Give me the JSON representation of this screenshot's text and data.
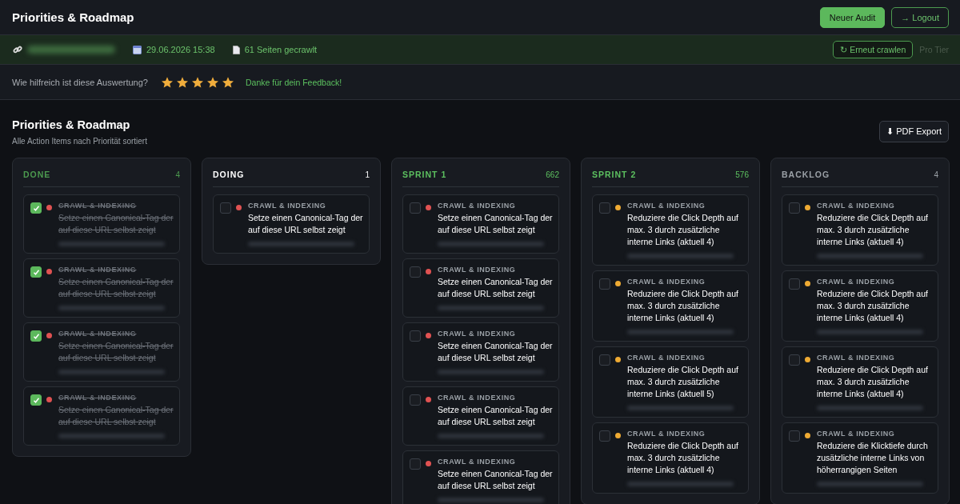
{
  "header": {
    "title": "Priorities & Roadmap",
    "buttons": [
      {
        "label": "Neuer Audit",
        "kind": "primary"
      },
      {
        "label": "→ Logout",
        "kind": "outline"
      }
    ]
  },
  "info_bar": {
    "date": "29.06.2026 15:38",
    "pages": "61 Seiten gecrawlt",
    "recrawl": "↻ Erneut crawlen",
    "tier": "Pro Tier"
  },
  "feedback": {
    "question": "Wie hilfreich ist diese Auswertung?",
    "stars": 5,
    "thanks": "Danke für dein Feedback!"
  },
  "section": {
    "title": "Priorities & Roadmap",
    "subtitle": "Alle Action Items nach Priorität sortiert",
    "export": "⬇ PDF Export"
  },
  "columns": [
    {
      "title": "DONE",
      "count": "4",
      "color": "#4c9a4f",
      "cards": [
        {
          "checked": true,
          "color": "#e05252",
          "category": "CRAWL & INDEXING",
          "title": "Setze einen Canonical-Tag der auf diese URL selbst zeigt"
        },
        {
          "checked": true,
          "color": "#e05252",
          "category": "CRAWL & INDEXING",
          "title": "Setze einen Canonical-Tag der auf diese URL selbst zeigt"
        },
        {
          "checked": true,
          "color": "#e05252",
          "category": "CRAWL & INDEXING",
          "title": "Setze einen Canonical-Tag der auf diese URL selbst zeigt"
        },
        {
          "checked": true,
          "color": "#e05252",
          "category": "CRAWL & INDEXING",
          "title": "Setze einen Canonical-Tag der auf diese URL selbst zeigt"
        }
      ]
    },
    {
      "title": "DOING",
      "count": "1",
      "color": "#ffffff",
      "cards": [
        {
          "checked": false,
          "color": "#e05252",
          "category": "CRAWL & INDEXING",
          "title": "Setze einen Canonical-Tag der auf diese URL selbst zeigt"
        }
      ]
    },
    {
      "title": "SPRINT 1",
      "count": "662",
      "color": "#5cc05f",
      "cards": [
        {
          "checked": false,
          "color": "#e05252",
          "category": "CRAWL & INDEXING",
          "title": "Setze einen Canonical-Tag der auf diese URL selbst zeigt"
        },
        {
          "checked": false,
          "color": "#e05252",
          "category": "CRAWL & INDEXING",
          "title": "Setze einen Canonical-Tag der auf diese URL selbst zeigt"
        },
        {
          "checked": false,
          "color": "#e05252",
          "category": "CRAWL & INDEXING",
          "title": "Setze einen Canonical-Tag der auf diese URL selbst zeigt"
        },
        {
          "checked": false,
          "color": "#e05252",
          "category": "CRAWL & INDEXING",
          "title": "Setze einen Canonical-Tag der auf diese URL selbst zeigt"
        },
        {
          "checked": false,
          "color": "#e05252",
          "category": "CRAWL & INDEXING",
          "title": "Setze einen Canonical-Tag der auf diese URL selbst zeigt"
        }
      ]
    },
    {
      "title": "SPRINT 2",
      "count": "576",
      "color": "#5cc05f",
      "cards": [
        {
          "checked": false,
          "color": "#eeaa33",
          "category": "CRAWL & INDEXING",
          "title": "Reduziere die Click Depth auf max. 3 durch zusätzliche interne Links (aktuell 4)"
        },
        {
          "checked": false,
          "color": "#eeaa33",
          "category": "CRAWL & INDEXING",
          "title": "Reduziere die Click Depth auf max. 3 durch zusätzliche interne Links (aktuell 4)"
        },
        {
          "checked": false,
          "color": "#eeaa33",
          "category": "CRAWL & INDEXING",
          "title": "Reduziere die Click Depth auf max. 3 durch zusätzliche interne Links (aktuell 5)"
        },
        {
          "checked": false,
          "color": "#eeaa33",
          "category": "CRAWL & INDEXING",
          "title": "Reduziere die Click Depth auf max. 3 durch zusätzliche interne Links (aktuell 4)"
        }
      ]
    },
    {
      "title": "BACKLOG",
      "count": "4",
      "color": "#9aa0a6",
      "cards": [
        {
          "checked": false,
          "color": "#eeaa33",
          "category": "CRAWL & INDEXING",
          "title": "Reduziere die Click Depth auf max. 3 durch zusätzliche interne Links (aktuell 4)"
        },
        {
          "checked": false,
          "color": "#eeaa33",
          "category": "CRAWL & INDEXING",
          "title": "Reduziere die Click Depth auf max. 3 durch zusätzliche interne Links (aktuell 4)"
        },
        {
          "checked": false,
          "color": "#eeaa33",
          "category": "CRAWL & INDEXING",
          "title": "Reduziere die Click Depth auf max. 3 durch zusätzliche interne Links (aktuell 4)"
        },
        {
          "checked": false,
          "color": "#eeaa33",
          "category": "CRAWL & INDEXING",
          "title": "Reduziere die Klicktiefe durch zusätzliche interne Links von höherrangigen Seiten"
        }
      ]
    }
  ]
}
